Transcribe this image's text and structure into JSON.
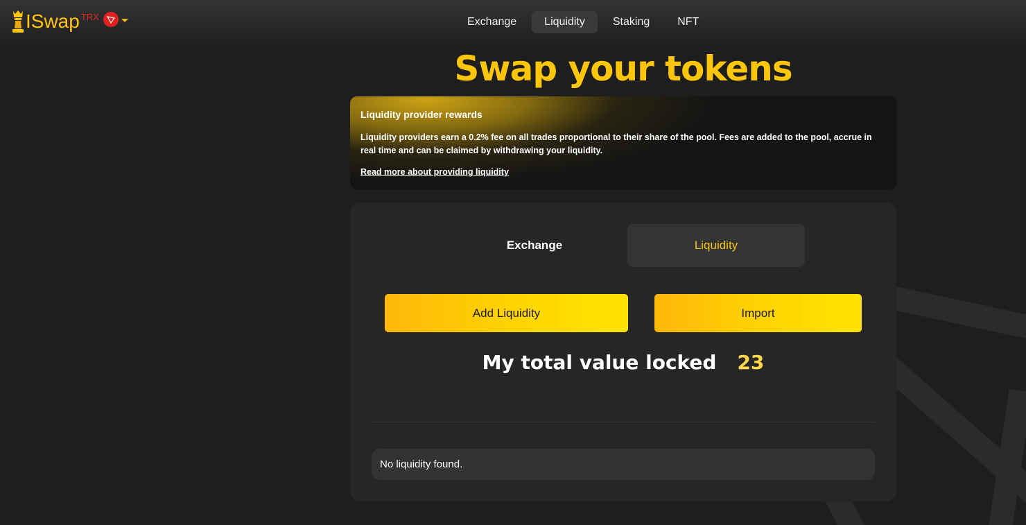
{
  "brand": {
    "name": "ISwap",
    "network": "TRX",
    "colors": {
      "accent": "#fdc60a",
      "network_badge": "#e32020"
    }
  },
  "nav": {
    "items": [
      {
        "label": "Exchange",
        "active": false
      },
      {
        "label": "Liquidity",
        "active": true
      },
      {
        "label": "Staking",
        "active": false
      },
      {
        "label": "NFT",
        "active": false
      }
    ]
  },
  "hero": {
    "title": "Swap your tokens"
  },
  "info": {
    "title": "Liquidity provider rewards",
    "body": "Liquidity providers earn a 0.2% fee on all trades proportional to their share of the pool. Fees are added to the pool, accrue in real time and can be claimed by withdrawing your liquidity.",
    "link": "Read more about providing liquidity"
  },
  "tabs": {
    "exchange": "Exchange",
    "liquidity": "Liquidity"
  },
  "actions": {
    "add_liquidity": "Add Liquidity",
    "import": "Import"
  },
  "tvl": {
    "label": "My total value locked",
    "value": "23"
  },
  "positions": {
    "empty_message": "No liquidity found."
  }
}
